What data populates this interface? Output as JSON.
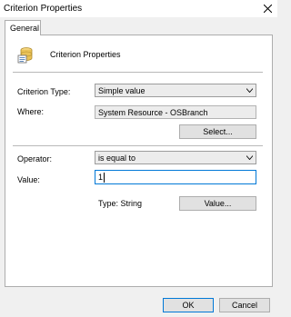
{
  "window": {
    "title": "Criterion Properties"
  },
  "tabs": [
    {
      "label": "General"
    }
  ],
  "header": {
    "label": "Criterion Properties",
    "icon": "criterion-properties-icon"
  },
  "form": {
    "criterion_type_label": "Criterion Type:",
    "criterion_type_value": "Simple value",
    "where_label": "Where:",
    "where_value": "System Resource - OSBranch",
    "select_button": "Select...",
    "operator_label": "Operator:",
    "operator_value": "is equal to",
    "value_label": "Value:",
    "value_value": "1",
    "type_text": "Type: String",
    "value_button": "Value..."
  },
  "footer": {
    "ok": "OK",
    "cancel": "Cancel"
  },
  "colors": {
    "accent": "#0078d7",
    "panel": "#ffffff",
    "chrome": "#f0f0f0",
    "button": "#e1e1e1"
  }
}
